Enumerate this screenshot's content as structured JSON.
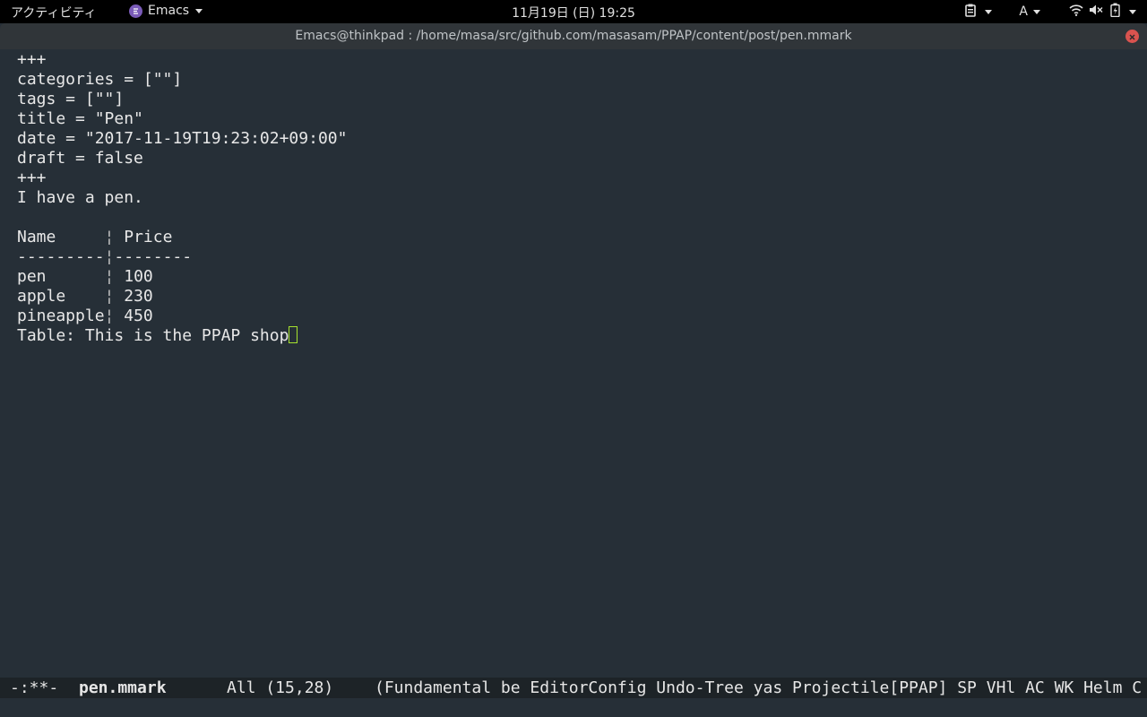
{
  "topbar": {
    "activities": "アクティビティ",
    "app_name": "Emacs",
    "clock": "11月19日 (日) 19:25",
    "input_method": "A"
  },
  "window": {
    "title": "Emacs@thinkpad : /home/masa/src/github.com/masasam/PPAP/content/post/pen.mmark"
  },
  "buffer": {
    "lines": {
      "l1": "+++",
      "l2": "categories = [\"\"]",
      "l3": "tags = [\"\"]",
      "l4": "title = \"Pen\"",
      "l5": "date = \"2017-11-19T19:23:02+09:00\"",
      "l6": "draft = false",
      "l7": "+++",
      "l8": "I have a pen.",
      "l9": "",
      "l14": "Table: This is the PPAP shop"
    },
    "table": {
      "separator": "¦",
      "header": {
        "name": "Name     ",
        "price": " Price"
      },
      "rule": {
        "left": "---------",
        "right": "--------"
      },
      "rows": [
        {
          "name": "pen      ",
          "price": " 100"
        },
        {
          "name": "apple    ",
          "price": " 230"
        },
        {
          "name": "pineapple",
          "price": " 450"
        }
      ]
    }
  },
  "modeline": {
    "status": "-:**-",
    "buffer_name": "pen.mmark",
    "position": "All (15,28)",
    "modes": "(Fundamental be EditorConfig Undo-Tree yas Projectile[PPAP] SP VHl AC WK Helm C"
  },
  "colors": {
    "background": "#262f37",
    "foreground": "#e8e8e8",
    "cursor": "#a6e22e",
    "modeline_bg": "#1d2327",
    "close_button": "#d9534f"
  },
  "icons": [
    "emacs-app-icon",
    "clipboard-icon",
    "wifi-icon",
    "volume-muted-icon",
    "battery-charging-icon",
    "close-icon"
  ]
}
